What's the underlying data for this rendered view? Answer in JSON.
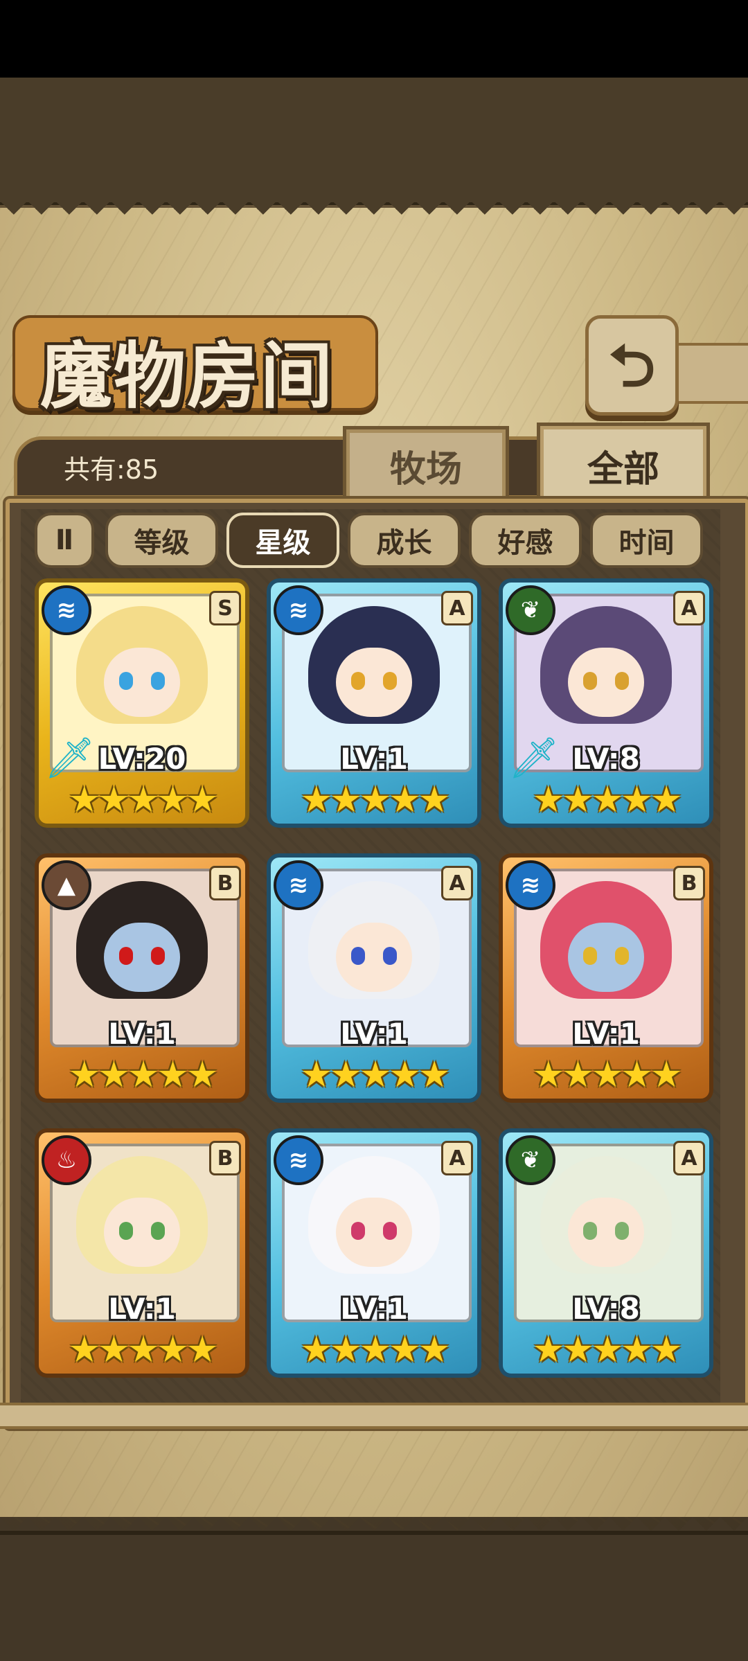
{
  "header": {
    "title": "魔物房间",
    "back_icon": "return-arrow-icon"
  },
  "summary": {
    "count_label": "共有:85"
  },
  "tabs": [
    {
      "label": "牧场",
      "active": false
    },
    {
      "label": "全部",
      "active": true
    }
  ],
  "sort": {
    "toggle_label": "Ⅱ",
    "buttons": [
      {
        "label": "等级",
        "active": false
      },
      {
        "label": "星级",
        "active": true
      },
      {
        "label": "成长",
        "active": false
      },
      {
        "label": "好感",
        "active": false
      },
      {
        "label": "时间",
        "active": false
      }
    ]
  },
  "monsters": [
    {
      "element": "water",
      "element_glyph": "≋",
      "rank": "S",
      "level": "LV:20",
      "stars": "★★★★★",
      "frame": "gold",
      "weapon": true
    },
    {
      "element": "water",
      "element_glyph": "≋",
      "rank": "A",
      "level": "LV:1",
      "stars": "★★★★★",
      "frame": "blue",
      "weapon": false
    },
    {
      "element": "nature",
      "element_glyph": "❦",
      "rank": "A",
      "level": "LV:8",
      "stars": "★★★★★",
      "frame": "blue",
      "weapon": true
    },
    {
      "element": "earth",
      "element_glyph": "▲",
      "rank": "B",
      "level": "LV:1",
      "stars": "★★★★★",
      "frame": "bronze",
      "weapon": false
    },
    {
      "element": "water",
      "element_glyph": "≋",
      "rank": "A",
      "level": "LV:1",
      "stars": "★★★★★",
      "frame": "blue",
      "weapon": false
    },
    {
      "element": "water",
      "element_glyph": "≋",
      "rank": "B",
      "level": "LV:1",
      "stars": "★★★★★",
      "frame": "bronze",
      "weapon": false
    },
    {
      "element": "fire",
      "element_glyph": "♨",
      "rank": "B",
      "level": "LV:1",
      "stars": "★★★★★",
      "frame": "bronze",
      "weapon": false
    },
    {
      "element": "water",
      "element_glyph": "≋",
      "rank": "A",
      "level": "LV:1",
      "stars": "★★★★★",
      "frame": "blue",
      "weapon": false
    },
    {
      "element": "nature",
      "element_glyph": "❦",
      "rank": "A",
      "level": "LV:8",
      "stars": "★★★★★",
      "frame": "blue",
      "weapon": false
    }
  ],
  "portrait_colors": {
    "hair": [
      "#f4dc8a",
      "#2a2f52",
      "#5b4a77",
      "#2b2320",
      "#eef0f4",
      "#e0516b",
      "#f4e6a8",
      "#f7f7fa",
      "#e9eedc"
    ],
    "eyes": [
      "#3aa3e0",
      "#e2a52b",
      "#d9a130",
      "#d01a1a",
      "#3a58c9",
      "#e2b52b",
      "#5aa452",
      "#cf3a6a",
      "#7fb06d"
    ],
    "bg": [
      "#fff4c4",
      "#dff2fb",
      "#e1d7ef",
      "#ead6c8",
      "#e8eef8",
      "#f6dcd8",
      "#f0e2c8",
      "#edf4fb",
      "#e6efdf"
    ]
  }
}
